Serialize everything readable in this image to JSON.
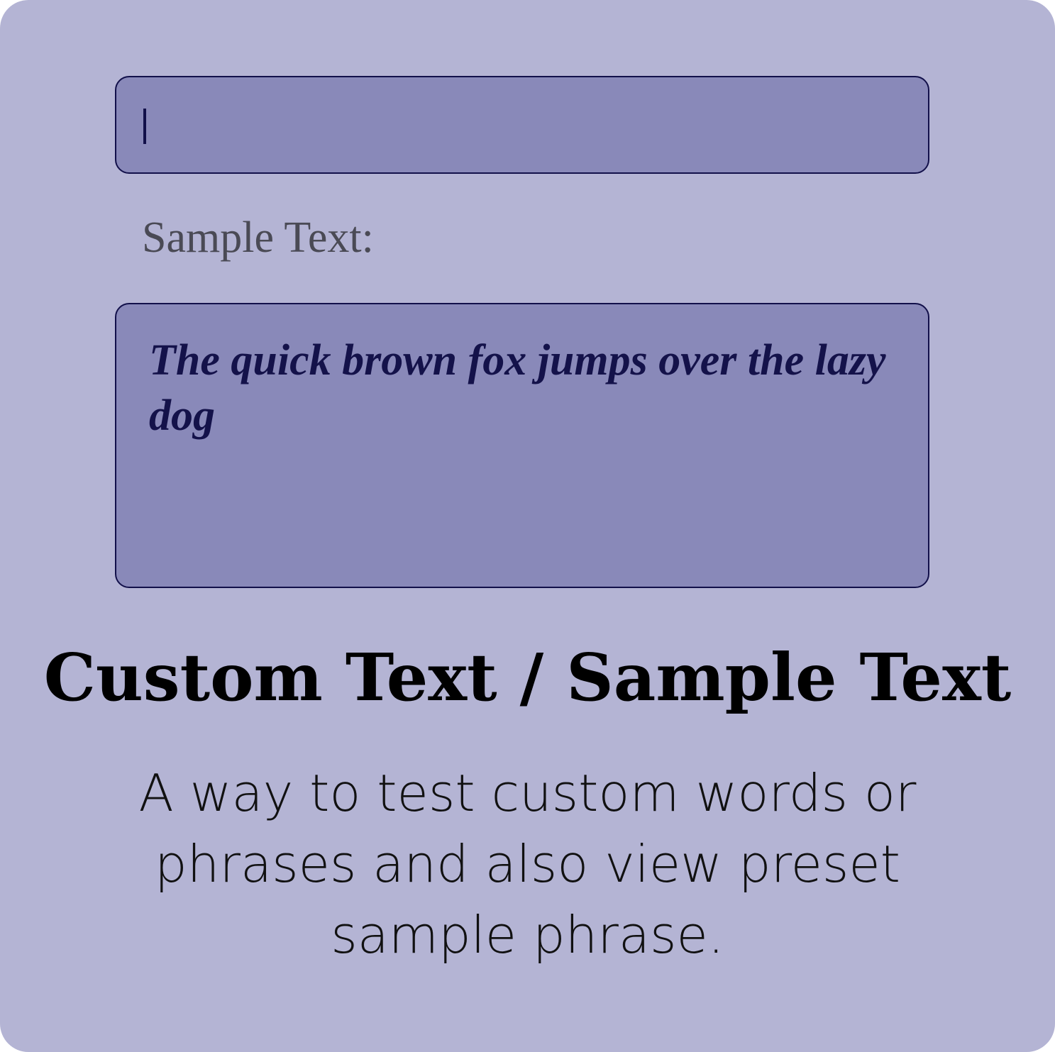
{
  "custom_input": {
    "value": ""
  },
  "sample_label": "Sample Text:",
  "sample_text": "The quick brown fox jumps over the lazy dog",
  "title": "Custom Text / Sample Text",
  "description": "A way to test custom words or phrases and also view preset sample phrase.",
  "colors": {
    "card_background": "#b4b4d4",
    "field_background": "#8989b9",
    "field_border": "#12104a",
    "label_text": "#4a4a55",
    "sample_text": "#14124a"
  }
}
